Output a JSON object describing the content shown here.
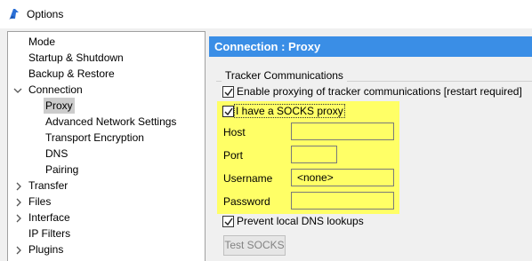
{
  "window": {
    "title": "Options"
  },
  "sidebar": {
    "items": [
      {
        "label": "Mode"
      },
      {
        "label": "Startup & Shutdown"
      },
      {
        "label": "Backup & Restore"
      },
      {
        "label": "Connection"
      },
      {
        "label": "Proxy"
      },
      {
        "label": "Advanced Network Settings"
      },
      {
        "label": "Transport Encryption"
      },
      {
        "label": "DNS"
      },
      {
        "label": "Pairing"
      },
      {
        "label": "Transfer"
      },
      {
        "label": "Files"
      },
      {
        "label": "Interface"
      },
      {
        "label": "IP Filters"
      },
      {
        "label": "Plugins"
      }
    ]
  },
  "page": {
    "header": "Connection : Proxy",
    "group_label": "Tracker Communications",
    "enable_proxy": {
      "label": "Enable proxying of tracker communications [restart required]",
      "checked": true
    },
    "socks_proxy": {
      "label": "I have a SOCKS proxy",
      "checked": true
    },
    "fields": {
      "host": {
        "label": "Host",
        "value": ""
      },
      "port": {
        "label": "Port",
        "value": ""
      },
      "username": {
        "label": "Username",
        "value": "<none>"
      },
      "password": {
        "label": "Password",
        "value": ""
      }
    },
    "prevent_dns": {
      "label": "Prevent local DNS lookups",
      "checked": true
    },
    "test_button": "Test SOCKS"
  },
  "colors": {
    "header_bg": "#3a8ee6",
    "highlight": "#ffff66",
    "selected_item": "#cccccc"
  },
  "icons": [
    "app-icon",
    "chevron-down-icon",
    "chevron-right-icon",
    "checkmark-icon"
  ]
}
